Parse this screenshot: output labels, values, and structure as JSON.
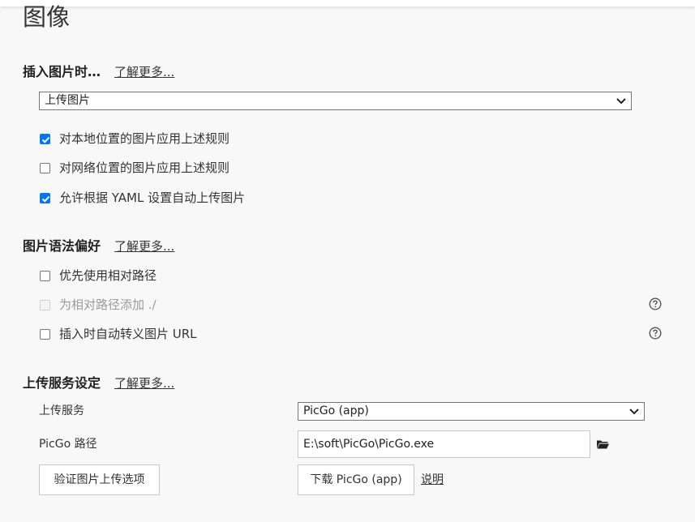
{
  "page": {
    "title": "图像"
  },
  "insert_section": {
    "heading": "插入图片时…",
    "learn_more": "了解更多...",
    "select_value": "上传图片",
    "options": [
      {
        "label": "对本地位置的图片应用上述规则",
        "checked": true,
        "disabled": false
      },
      {
        "label": "对网络位置的图片应用上述规则",
        "checked": false,
        "disabled": false
      },
      {
        "label": "允许根据 YAML 设置自动上传图片",
        "checked": true,
        "disabled": false
      }
    ]
  },
  "syntax_section": {
    "heading": "图片语法偏好",
    "learn_more": "了解更多...",
    "options": [
      {
        "label": "优先使用相对路径",
        "checked": false,
        "disabled": false,
        "help": false
      },
      {
        "label": "为相对路径添加 ./",
        "checked": false,
        "disabled": true,
        "help": true
      },
      {
        "label": "插入时自动转义图片 URL",
        "checked": false,
        "disabled": false,
        "help": true
      }
    ]
  },
  "upload_section": {
    "heading": "上传服务设定",
    "learn_more": "了解更多...",
    "service_label": "上传服务",
    "service_value": "PicGo (app)",
    "path_label": "PicGo 路径",
    "path_value": "E:\\soft\\PicGo\\PicGo.exe",
    "verify_button": "验证图片上传选项",
    "download_button": "下载 PicGo (app)",
    "help_link": "说明"
  },
  "icons": {
    "chevron": "chevron-down-icon",
    "help": "question-circle-icon",
    "folder": "folder-icon",
    "check": "checkmark-icon"
  },
  "colors": {
    "checkbox_checked": "#0075ff",
    "background": "#f8f8f8"
  }
}
